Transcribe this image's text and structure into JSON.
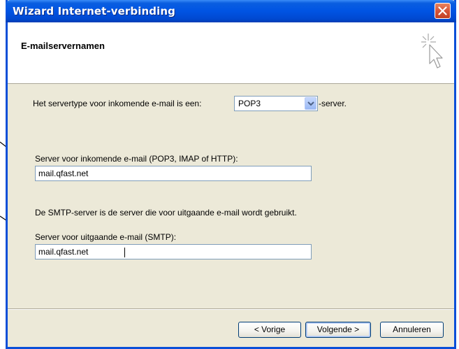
{
  "window": {
    "title": "Wizard Internet-verbinding"
  },
  "header": {
    "title": "E-mailservernamen"
  },
  "server_type": {
    "label_before": "Het servertype voor inkomende e-mail is een:",
    "selected": "POP3",
    "label_after": "-server."
  },
  "incoming": {
    "label": "Server voor inkomende e-mail (POP3, IMAP of HTTP):",
    "value": "mail.qfast.net"
  },
  "smtp_info": "De SMTP-server is de server die voor uitgaande e-mail wordt gebruikt.",
  "outgoing": {
    "label": "Server voor uitgaande e-mail (SMTP):",
    "value": "mail.qfast.net"
  },
  "buttons": {
    "back": "< Vorige",
    "next": "Volgende >",
    "cancel": "Annuleren"
  },
  "colors": {
    "titlebar": "#0054e3",
    "close": "#d5553a",
    "dialog_bg": "#ece9d8",
    "input_border": "#7f9db9"
  },
  "icons": {
    "close": "close-icon",
    "wizard": "wizard-sparkle-cursor-icon",
    "dropdown": "chevron-down-icon"
  }
}
